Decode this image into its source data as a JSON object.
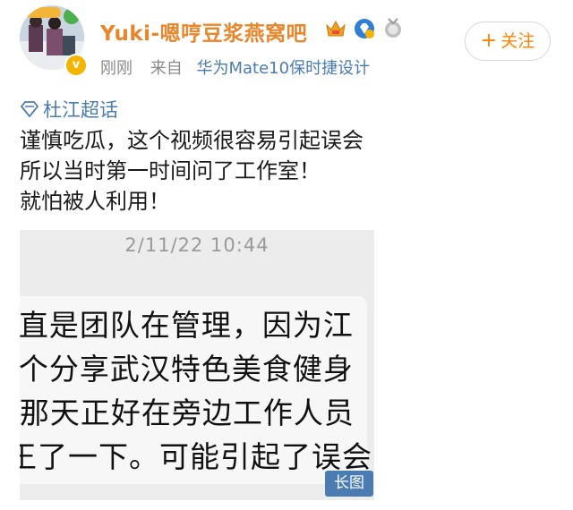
{
  "post": {
    "username": "Yuki-嗯哼豆浆燕窝吧",
    "time": "刚刚",
    "from_label": "来自",
    "device": "华为Mate10保时捷设计",
    "follow_label": "关注",
    "follow_plus": "+",
    "topic": "杜江超话",
    "lines": [
      "谨慎吃瓜，这个视频很容易引起误会",
      "所以当时第一时间问了工作室！",
      "就怕被人利用！"
    ]
  },
  "screenshot": {
    "timestamp": "2/11/22 10:44",
    "chat_lines": [
      "-直是团队在管理，因为江",
      "-个分享武汉特色美食健身",
      ")那天正好在旁边工作人员",
      "王了一下。可能引起了误会"
    ],
    "long_image_tag": "长图"
  },
  "icons": {
    "avatar": "avatar-icon",
    "vip": "vip-badge-icon",
    "crown": "crown-badge-icon",
    "diamond": "diamond-badge-icon",
    "medal": "medal-badge-icon",
    "topic": "topic-diamond-icon"
  },
  "colors": {
    "username": "#e8862b",
    "link": "#4a7cb1",
    "follow": "#ff8200",
    "meta": "#8a8a8a"
  }
}
